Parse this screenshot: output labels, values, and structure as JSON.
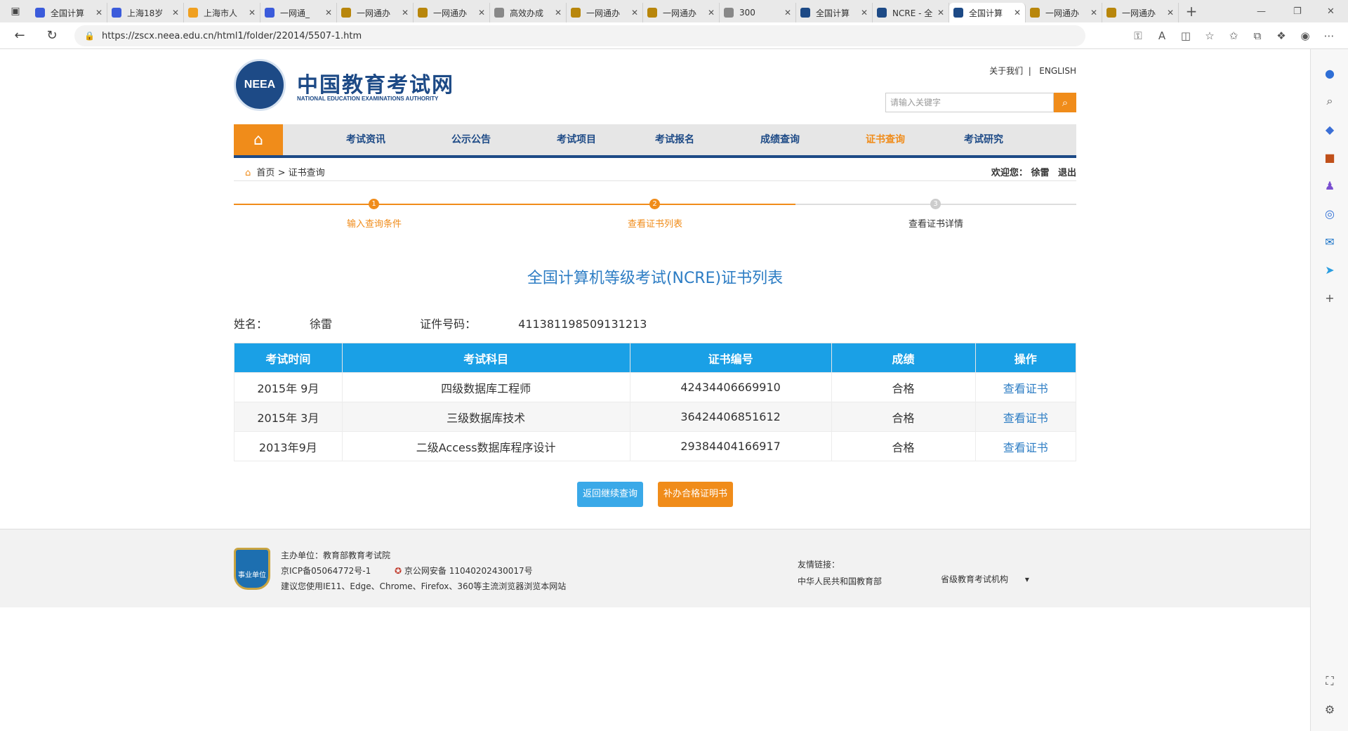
{
  "browser": {
    "tabs": [
      {
        "title": "全国计算",
        "icon_color": "#3b5bdb",
        "active": false
      },
      {
        "title": "上海18岁",
        "icon_color": "#3b5bdb",
        "active": false
      },
      {
        "title": "上海市人",
        "icon_color": "#f0a020",
        "active": false
      },
      {
        "title": "一网通_",
        "icon_color": "#3b5bdb",
        "active": false
      },
      {
        "title": "一网通办",
        "icon_color": "#b8860b",
        "active": false
      },
      {
        "title": "一网通办",
        "icon_color": "#b8860b",
        "active": false
      },
      {
        "title": "高效办成",
        "icon_color": "#888888",
        "active": false
      },
      {
        "title": "一网通办",
        "icon_color": "#b8860b",
        "active": false
      },
      {
        "title": "一网通办",
        "icon_color": "#b8860b",
        "active": false
      },
      {
        "title": "300",
        "icon_color": "#888888",
        "active": false
      },
      {
        "title": "全国计算",
        "icon_color": "#1d4a86",
        "active": false
      },
      {
        "title": "NCRE - 全",
        "icon_color": "#1d4a86",
        "active": false
      },
      {
        "title": "全国计算",
        "icon_color": "#1d4a86",
        "active": true
      },
      {
        "title": "一网通办",
        "icon_color": "#b8860b",
        "active": false
      },
      {
        "title": "一网通办",
        "icon_color": "#b8860b",
        "active": false
      }
    ],
    "url": "https://zscx.neea.edu.cn/html1/folder/22014/5507-1.htm"
  },
  "header": {
    "logo_text": "NEEA",
    "title": "中国教育考试网",
    "subtitle": "NATIONAL EDUCATION EXAMINATIONS AUTHORITY",
    "about_link": "关于我们",
    "english_link": "ENGLISH",
    "search_placeholder": "请输入关键字"
  },
  "nav": {
    "items": [
      "考试资讯",
      "公示公告",
      "考试项目",
      "考试报名",
      "成绩查询",
      "证书查询",
      "考试研究"
    ],
    "active_index": 5
  },
  "breadcrumb": {
    "home": "首页",
    "sep": ">",
    "current": "证书查询",
    "welcome": "欢迎您：",
    "user": "徐雷",
    "logout": "退出"
  },
  "steps": [
    {
      "num": "1",
      "label": "输入查询条件",
      "done": true
    },
    {
      "num": "2",
      "label": "查看证书列表",
      "done": true
    },
    {
      "num": "3",
      "label": "查看证书详情",
      "done": false
    }
  ],
  "colors": {
    "accent": "#f08c1a",
    "primary": "#1d4a86",
    "table_header": "#1aa0e6",
    "link": "#2d7dc4"
  },
  "list_title": "全国计算机等级考试(NCRE)证书列表",
  "person": {
    "name_label": "姓名：",
    "name": "徐雷",
    "id_label": "证件号码：",
    "id": "411381198509131213"
  },
  "table": {
    "headers": [
      "考试时间",
      "考试科目",
      "证书编号",
      "成绩",
      "操作"
    ],
    "rows": [
      [
        "2015年 9月",
        "四级数据库工程师",
        "42434406669910",
        "合格",
        "查看证书"
      ],
      [
        "2015年 3月",
        "三级数据库技术",
        "36424406851612",
        "合格",
        "查看证书"
      ],
      [
        "2013年9月",
        "二级Access数据库程序设计",
        "29384404166917",
        "合格",
        "查看证书"
      ]
    ]
  },
  "buttons": {
    "back": "返回继续查询",
    "reissue": "补办合格证明书"
  },
  "footer": {
    "badge": "事业单位",
    "host": "主办单位：教育部教育考试院",
    "icp": "京ICP备05064772号-1",
    "police": "京公网安备 11040202430017号",
    "browser_tip": "建议您使用IE11、Edge、Chrome、Firefox、360等主流浏览器浏览本网站",
    "friend_label": "友情链接：",
    "friend_link": "中华人民共和国教育部",
    "select_value": "省级教育考试机构"
  }
}
